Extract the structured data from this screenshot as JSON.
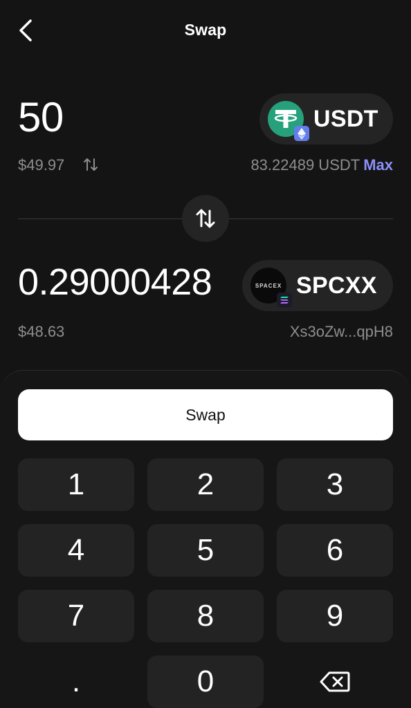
{
  "header": {
    "title": "Swap"
  },
  "from": {
    "amount": "50",
    "usd_value": "$49.97",
    "token_symbol": "USDT",
    "balance": "83.22489 USDT",
    "max_label": "Max"
  },
  "to": {
    "amount": "0.29000428",
    "usd_value": "$48.63",
    "token_symbol": "SPCXX",
    "address": "Xs3oZw...qpH8",
    "logo_text": "SPACEX"
  },
  "swap_button_label": "Swap",
  "keypad": {
    "k1": "1",
    "k2": "2",
    "k3": "3",
    "k4": "4",
    "k5": "5",
    "k6": "6",
    "k7": "7",
    "k8": "8",
    "k9": "9",
    "dot": ".",
    "k0": "0"
  },
  "colors": {
    "background": "#141414",
    "accent": "#8b8ff7",
    "usdt_green": "#26a17b",
    "eth_blue": "#627eea"
  }
}
